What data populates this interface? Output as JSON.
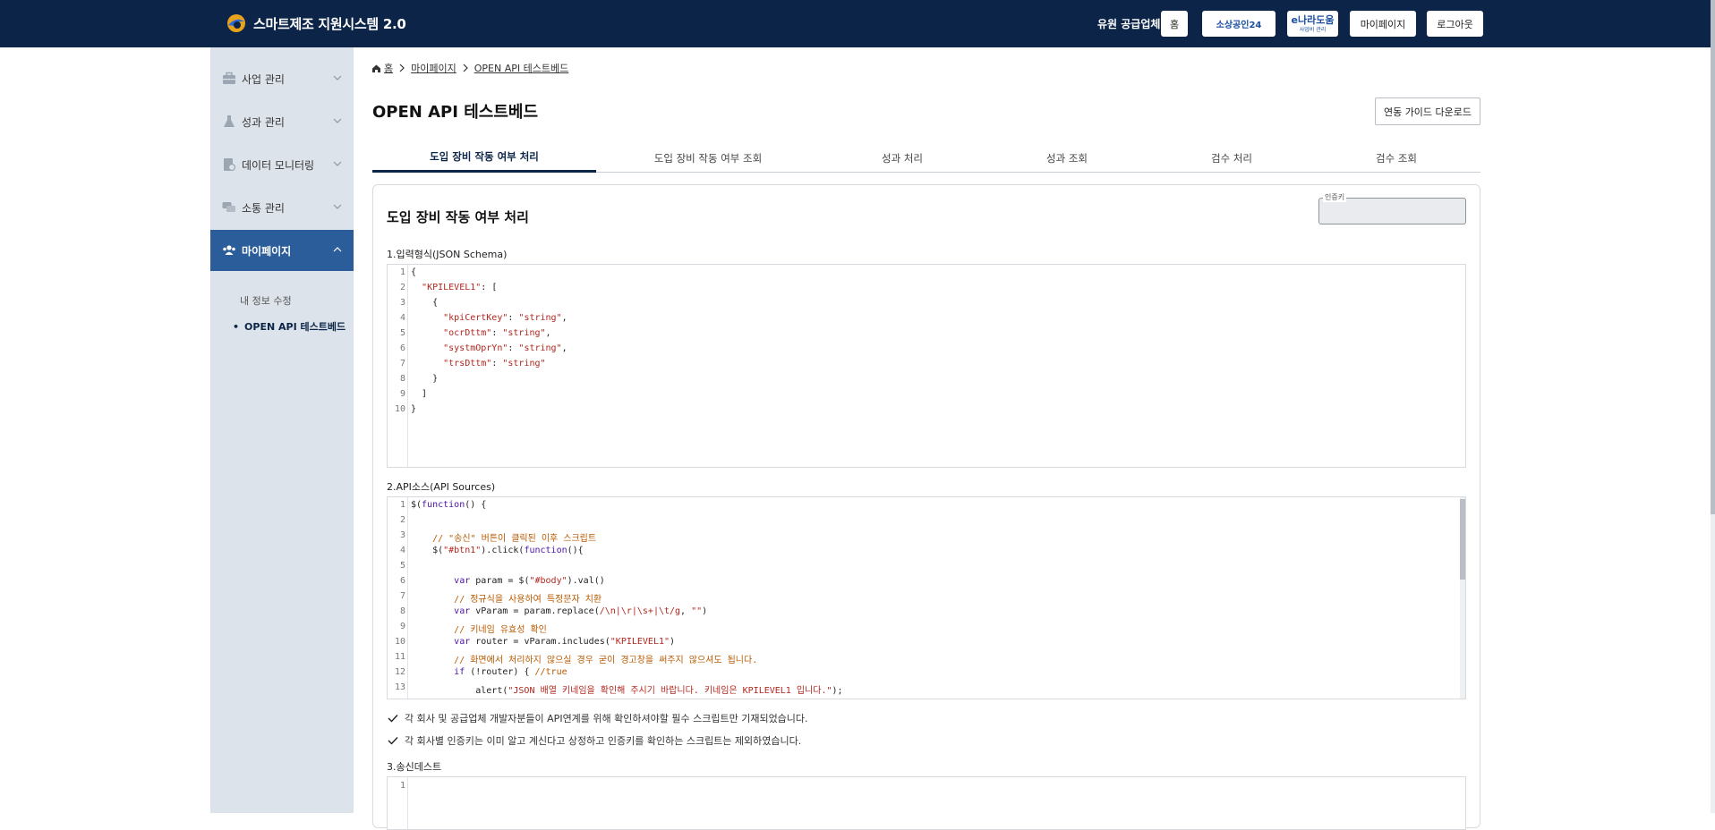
{
  "header": {
    "app_title": "스마트제조 지원시스템 2.0",
    "company": "유원 공급업체",
    "home_label": "홈",
    "partner1": "소상공인24",
    "partner2": "e나라도움",
    "partner2_sub": "사업비 관리",
    "mypage_label": "마이페이지",
    "logout_label": "로그아웃",
    "colors": {
      "nav_bg": "#0b2447",
      "accent": "#2a5d99"
    }
  },
  "sidebar": {
    "items": [
      {
        "label": "사업 관리",
        "icon": "briefcase-icon"
      },
      {
        "label": "성과 관리",
        "icon": "flask-icon"
      },
      {
        "label": "데이터 모니터링",
        "icon": "document-monitor-icon"
      },
      {
        "label": "소통 관리",
        "icon": "chat-icon"
      },
      {
        "label": "마이페이지",
        "icon": "users-icon",
        "active": true
      }
    ],
    "sub_items": [
      {
        "label": "내 정보 수정"
      },
      {
        "label": "OPEN API 테스트베드",
        "current": true
      }
    ]
  },
  "breadcrumb": [
    "홈",
    "마이페이지",
    "OPEN API 테스트베드"
  ],
  "page": {
    "title": "OPEN API 테스트베드",
    "guide_button": "연동 가이드 다운로드"
  },
  "tabs": [
    {
      "label": "도입 장비 작동 여부 처리",
      "active": true
    },
    {
      "label": "도입 장비 작동 여부 조회"
    },
    {
      "label": "성과 처리"
    },
    {
      "label": "성과 조회"
    },
    {
      "label": "검수 처리"
    },
    {
      "label": "검수 조회"
    }
  ],
  "panel": {
    "title": "도입 장비 작동 여부 처리",
    "auth_label": "인증키",
    "section1_label": "1.입력형식(JSON Schema)",
    "section2_label": "2.API소스(API Sources)",
    "section3_label": "3.송신데스트",
    "notes": [
      "각 회사 및 공급업체 개발자분들이 API연계를 위해 확인하셔야할 필수 스크립트만 기재되었습니다.",
      "각 회사별 인증키는 이미 알고 계신다고 상정하고 인증키를 확인하는 스크립트는 제외하였습니다."
    ]
  },
  "schema_lines": [
    "{",
    "  \"KPILEVEL1\": [",
    "    {",
    "      \"kpiCertKey\": \"string\",",
    "      \"ocrDttm\": \"string\",",
    "      \"systmOprYn\": \"string\",",
    "      \"trsDttm\": \"string\"",
    "    }",
    "  ]",
    "}"
  ],
  "source_lines": [
    "$(function() {",
    "",
    "    // \"송신\" 버튼이 클릭된 이후 스크립트",
    "    $(\"#btn1\").click(function(){",
    "",
    "        var param = $(\"#body\").val()",
    "        // 정규식을 사용하여 특정문자 치환",
    "        var vParam = param.replace(/\\n|\\r|\\s+|\\t/g, \"\")",
    "        // 키네임 유효성 확인",
    "        var router = vParam.includes(\"KPILEVEL1\")",
    "        // 화면에서 처리하지 않으실 경우 굳이 경고창을 써주지 않으셔도 됩니다.",
    "        if (!router) { //true",
    "            alert(\"JSON 배열 키네임을 확인해 주시기 바랍니다. 키네임은 KPILEVEL1 입니다.\");"
  ],
  "test_lines": [
    ""
  ]
}
